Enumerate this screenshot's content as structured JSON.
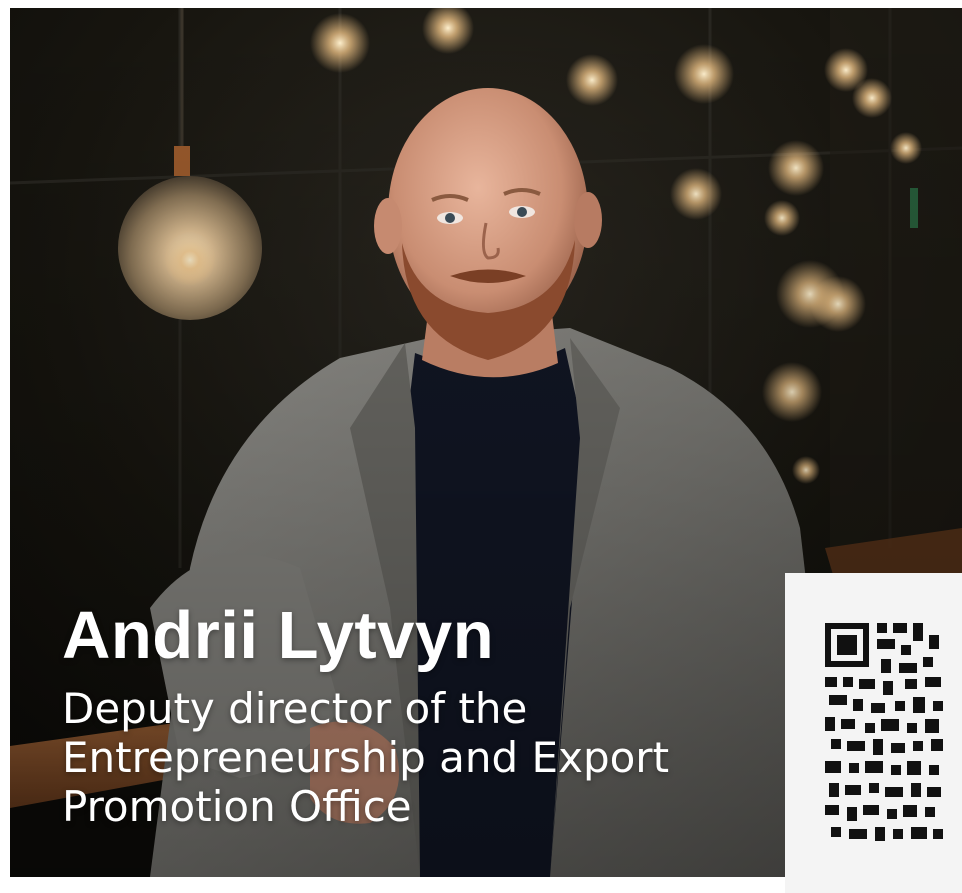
{
  "person": {
    "name": "Andrii Lytvyn",
    "title_lines": [
      "Deputy director of the",
      "Entrepreneurship and Export",
      "Promotion Office"
    ]
  },
  "photo": {
    "subject": "bald-bearded-man-grey-blazer",
    "background": "dark-interior-with-pendant-lamps"
  },
  "qr": {
    "icon": "qr-code-icon"
  },
  "colors": {
    "background": "#16140f",
    "blazer": "#8a8985",
    "sweater": "#121726",
    "skin": "#d7a088",
    "beard": "#8a4a2e",
    "caption_text": "#ffffff",
    "card": "#f4f4f4",
    "qr_modules": "#111111",
    "lamp_glow": "#f6c98a"
  }
}
